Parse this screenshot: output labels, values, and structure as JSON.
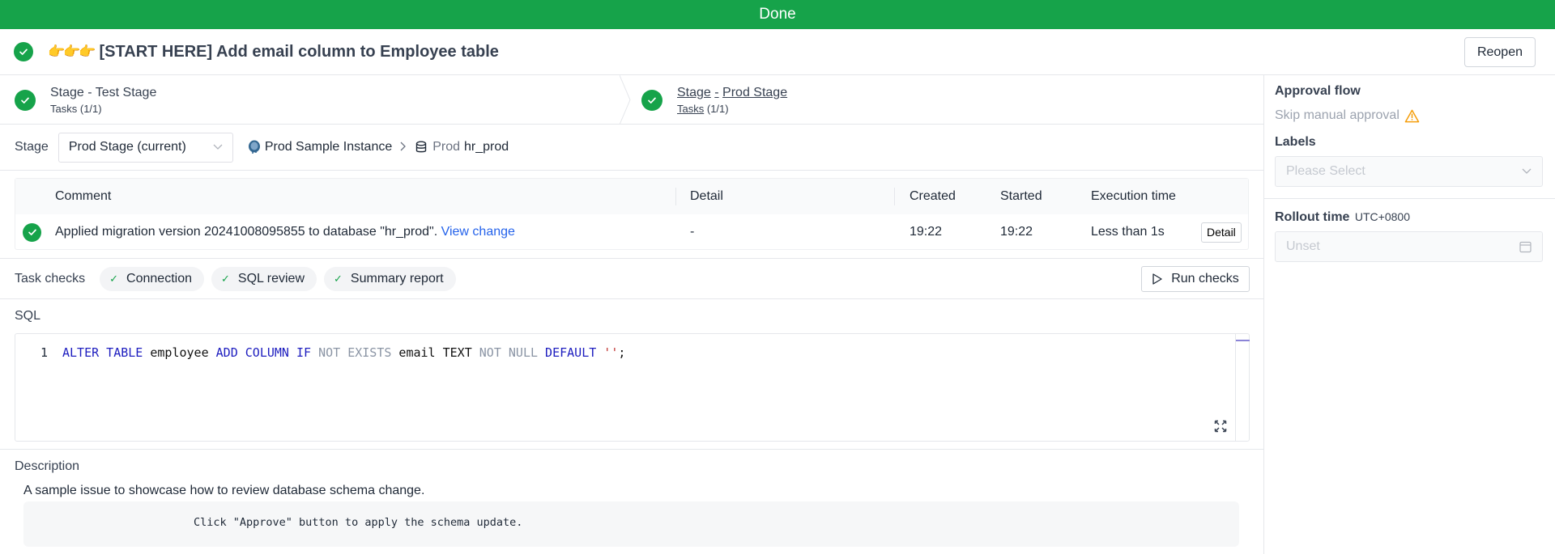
{
  "banner": {
    "status": "Done"
  },
  "header": {
    "emoji": "👉👉👉",
    "title": "[START HERE] Add email column to Employee table",
    "reopen_label": "Reopen"
  },
  "stages": [
    {
      "title_prefix": "Stage",
      "title_sep": "-",
      "title_name": "Test Stage",
      "tasks_label": "Tasks",
      "tasks_count": "(1/1)",
      "status": "done"
    },
    {
      "title_prefix": "Stage",
      "title_sep": "-",
      "title_name": "Prod Stage",
      "tasks_label": "Tasks",
      "tasks_count": "(1/1)",
      "status": "done",
      "active": true
    }
  ],
  "stage_selector": {
    "label": "Stage",
    "value": "Prod Stage (current)",
    "instance": "Prod Sample Instance",
    "environment": "Prod",
    "database": "hr_prod"
  },
  "task_table": {
    "columns": [
      "Comment",
      "Detail",
      "Created",
      "Started",
      "Execution time"
    ],
    "rows": [
      {
        "status": "success",
        "comment": "Applied migration version 20241008095855 to database \"hr_prod\".",
        "comment_link": "View change",
        "detail": "-",
        "created": "19:22",
        "started": "19:22",
        "execution_time": "Less than 1s",
        "action": "Detail"
      }
    ]
  },
  "task_checks": {
    "label": "Task checks",
    "checks": [
      {
        "name": "Connection",
        "status": "pass"
      },
      {
        "name": "SQL review",
        "status": "pass"
      },
      {
        "name": "Summary report",
        "status": "pass"
      }
    ],
    "run_label": "Run checks"
  },
  "sql": {
    "label": "SQL",
    "line_number": "1",
    "tokens": [
      {
        "t": "ALTER TABLE",
        "c": "kw"
      },
      {
        "t": " employee ",
        "c": "id"
      },
      {
        "t": "ADD COLUMN IF",
        "c": "kw"
      },
      {
        "t": " NOT EXISTS",
        "c": "kw2"
      },
      {
        "t": " email TEXT ",
        "c": "id"
      },
      {
        "t": "NOT NULL",
        "c": "kw2"
      },
      {
        "t": " DEFAULT",
        "c": "kw"
      },
      {
        "t": " ''",
        "c": "str"
      },
      {
        "t": ";",
        "c": "id"
      }
    ]
  },
  "description": {
    "label": "Description",
    "text": "A sample issue to showcase how to review database schema change.",
    "code": "Click \"Approve\" button to apply the schema update."
  },
  "sidebar": {
    "approval_flow_label": "Approval flow",
    "approval_flow_value": "Skip manual approval",
    "labels_label": "Labels",
    "labels_placeholder": "Please Select",
    "rollout_label": "Rollout time",
    "rollout_tz": "UTC+0800",
    "rollout_placeholder": "Unset"
  },
  "colors": {
    "success": "#16a34a",
    "link": "#2563eb",
    "warning": "#f59e0b"
  }
}
